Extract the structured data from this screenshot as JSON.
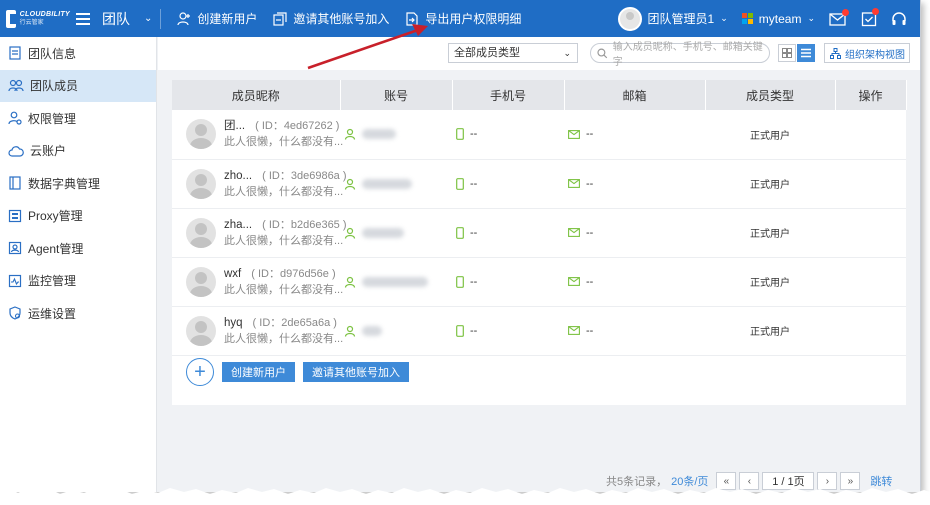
{
  "topbar": {
    "logo_text": "CLOUDBILITY",
    "logo_sub": "行云管家",
    "section_title": "团队",
    "actions": [
      {
        "label": "创建新用户",
        "icon": "add-user-icon"
      },
      {
        "label": "邀请其他账号加入",
        "icon": "invite-icon"
      },
      {
        "label": "导出用户权限明细",
        "icon": "export-icon"
      }
    ],
    "user_name": "团队管理员1",
    "team_name": "myteam",
    "icons": [
      "mail-notification-icon",
      "task-check-icon",
      "headset-support-icon"
    ]
  },
  "sidebar": {
    "items": [
      {
        "label": "团队信息",
        "icon": "info-doc-icon",
        "active": false
      },
      {
        "label": "团队成员",
        "icon": "members-icon",
        "active": true
      },
      {
        "label": "权限管理",
        "icon": "permission-user-icon",
        "active": false
      },
      {
        "label": "云账户",
        "icon": "cloud-icon",
        "active": false
      },
      {
        "label": "数据字典管理",
        "icon": "dictionary-icon",
        "active": false
      },
      {
        "label": "Proxy管理",
        "icon": "proxy-icon",
        "active": false
      },
      {
        "label": "Agent管理",
        "icon": "agent-icon",
        "active": false
      },
      {
        "label": "监控管理",
        "icon": "monitor-icon",
        "active": false
      },
      {
        "label": "运维设置",
        "icon": "ops-settings-icon",
        "active": false
      }
    ]
  },
  "filters": {
    "member_type": "全部成员类型",
    "search_placeholder": "输入成员昵称、手机号、邮箱关键字",
    "org_view_label": "组织架构视图"
  },
  "table": {
    "columns": [
      "成员昵称",
      "账号",
      "手机号",
      "邮箱",
      "成员类型",
      "操作"
    ],
    "rows": [
      {
        "name": "团...",
        "id": "( ID：4ed67262 )",
        "sign": "此人很懒，什么都没有...",
        "phone": "--",
        "email": "--",
        "type": "正式用户",
        "acct_w": 34
      },
      {
        "name": "zho...",
        "id": "( ID：3de6986a )",
        "sign": "此人很懒，什么都没有...",
        "phone": "--",
        "email": "--",
        "type": "正式用户",
        "acct_w": 50
      },
      {
        "name": "zha...",
        "id": "( ID：b2d6e365 )",
        "sign": "此人很懒，什么都没有...",
        "phone": "--",
        "email": "--",
        "type": "正式用户",
        "acct_w": 42
      },
      {
        "name": "wxf",
        "id": "( ID：d976d56e )",
        "sign": "此人很懒，什么都没有...",
        "phone": "--",
        "email": "--",
        "type": "正式用户",
        "acct_w": 66
      },
      {
        "name": "hyq",
        "id": "( ID：2de65a6a )",
        "sign": "此人很懒，什么都没有...",
        "phone": "--",
        "email": "--",
        "type": "正式用户",
        "acct_w": 20
      }
    ]
  },
  "bottom_actions": {
    "create_label": "创建新用户",
    "invite_label": "邀请其他账号加入"
  },
  "pagination": {
    "total_text": "共5条记录，",
    "per_page_text": "20条/页",
    "first": "«",
    "prev": "‹",
    "page_text": "1 / 1页",
    "next": "›",
    "last": "»",
    "jump_text": "跳转"
  },
  "colors": {
    "brand": "#1f6dc5",
    "accent": "#3e8ad8",
    "green_icon": "#7cc242",
    "annotation_arrow": "#c8202a"
  }
}
